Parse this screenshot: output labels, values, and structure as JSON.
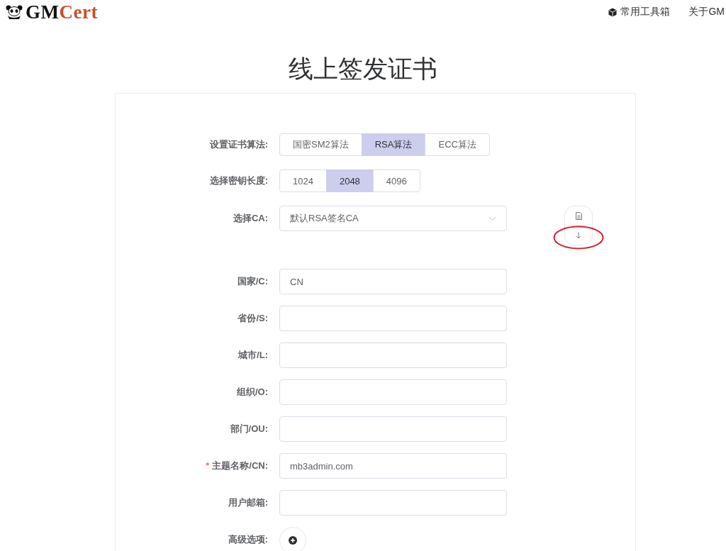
{
  "header": {
    "logo": [
      {
        "text": "GM",
        "color": "#111111"
      },
      {
        "text": "Cert",
        "color": "#c8512b"
      }
    ],
    "nav": [
      {
        "label": "常用工具箱",
        "kind": "toolbox"
      },
      {
        "label": "关于GM",
        "kind": "plain"
      }
    ]
  },
  "title": "线上签发证书",
  "form": {
    "rows": [
      {
        "kind": "segmented",
        "label": "设置证书算法:",
        "options": [
          {
            "label": "国密SM2算法",
            "selected": false
          },
          {
            "label": "RSA算法",
            "selected": true
          },
          {
            "label": "ECC算法",
            "selected": false
          }
        ]
      },
      {
        "kind": "segmented",
        "label": "选择密钥长度:",
        "options": [
          {
            "label": "1024",
            "selected": false
          },
          {
            "label": "2048",
            "selected": true
          },
          {
            "label": "4096",
            "selected": false
          }
        ]
      },
      {
        "kind": "select",
        "label": "选择CA:",
        "value": "默认RSA签名CA"
      },
      {
        "kind": "input",
        "label": "国家/C:",
        "value": "CN"
      },
      {
        "kind": "input",
        "label": "省份/S:"
      },
      {
        "kind": "input",
        "label": "城市/L:"
      },
      {
        "kind": "input",
        "label": "组织/O:"
      },
      {
        "kind": "input",
        "label": "部门/OU:"
      },
      {
        "kind": "input",
        "label": "主题名称/CN:",
        "value": "mb3admin.com",
        "required_mark": "*"
      },
      {
        "kind": "input",
        "label": "用户邮箱:"
      },
      {
        "kind": "advanced",
        "label": "高级选项:"
      }
    ]
  }
}
